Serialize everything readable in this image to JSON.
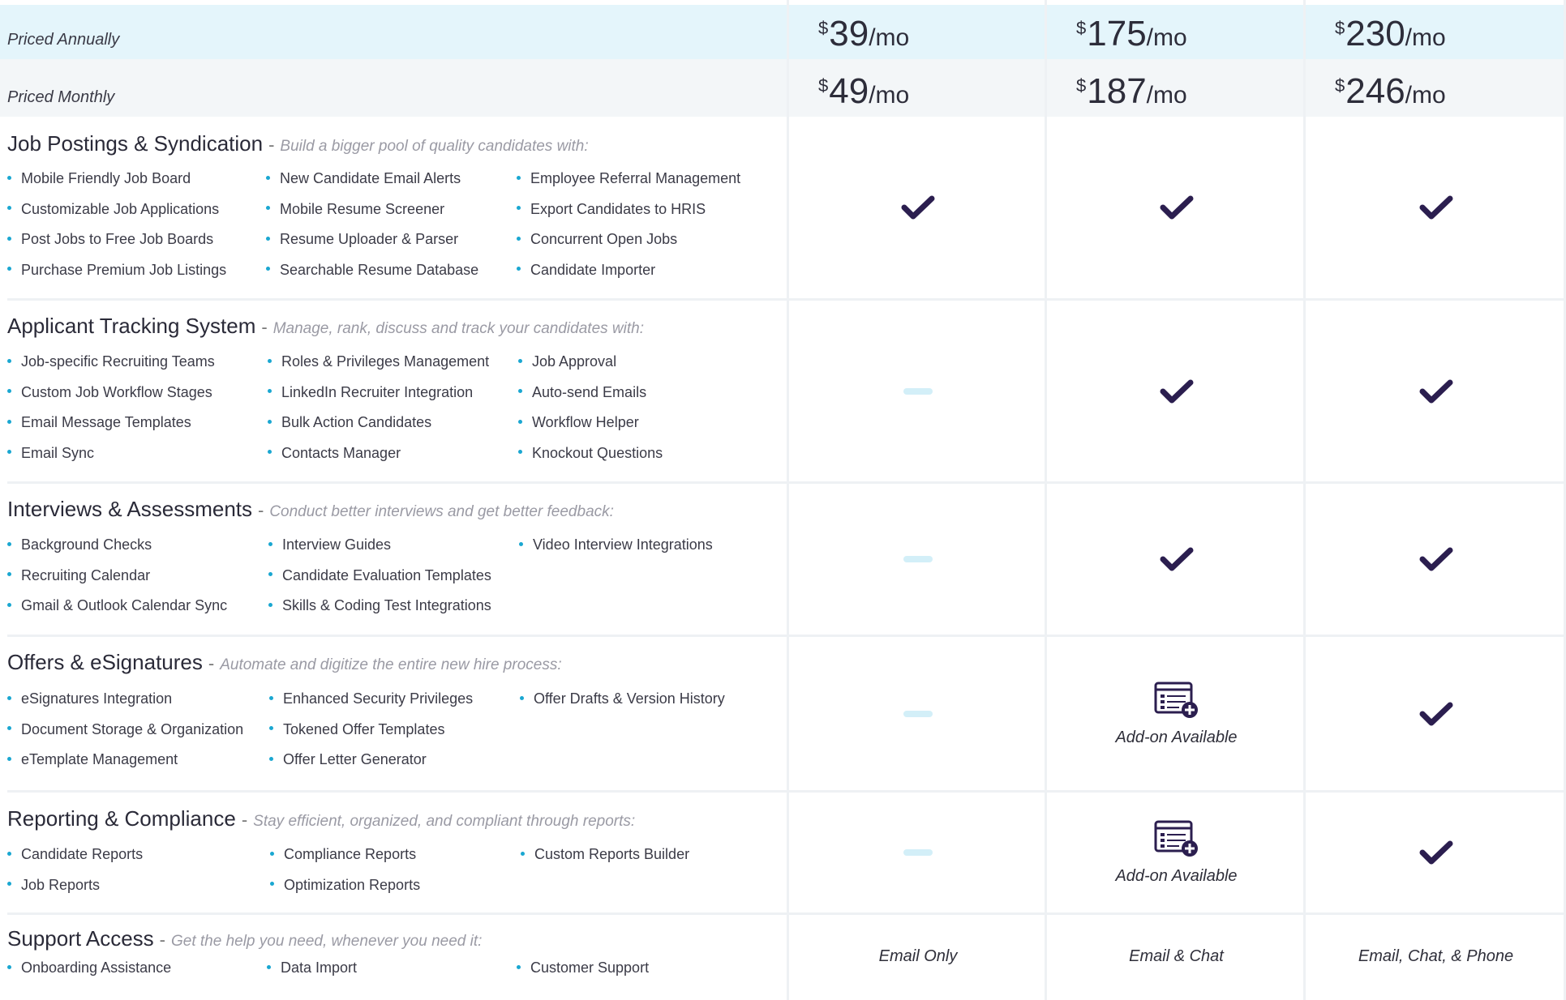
{
  "pricing": {
    "annual_label": "Priced Annually",
    "monthly_label": "Priced Monthly",
    "currency": "$",
    "per": "/mo",
    "annual": [
      "39",
      "175",
      "230"
    ],
    "monthly": [
      "49",
      "187",
      "246"
    ]
  },
  "sections": [
    {
      "title": "Job Postings & Syndication",
      "dash": "-",
      "subtitle": "Build a bigger pool of quality candidates with:",
      "features": [
        [
          "Mobile Friendly Job Board",
          "Customizable Job Applications",
          "Post Jobs to Free Job Boards",
          "Purchase Premium Job Listings"
        ],
        [
          "New Candidate Email Alerts",
          "Mobile Resume Screener",
          "Resume Uploader & Parser",
          "Searchable Resume Database"
        ],
        [
          "Employee Referral Management",
          "Export Candidates to HRIS",
          "Concurrent Open Jobs",
          "Candidate Importer"
        ]
      ],
      "tiers": [
        "check",
        "check",
        "check"
      ]
    },
    {
      "title": "Applicant Tracking System",
      "dash": "-",
      "subtitle": "Manage, rank, discuss and track your candidates with:",
      "features": [
        [
          "Job-specific Recruiting Teams",
          "Custom Job Workflow Stages",
          "Email Message Templates",
          "Email Sync"
        ],
        [
          "Roles & Privileges Management",
          "LinkedIn Recruiter Integration",
          "Bulk Action Candidates",
          "Contacts Manager"
        ],
        [
          "Job Approval",
          "Auto-send Emails",
          "Workflow Helper",
          "Knockout Questions"
        ]
      ],
      "tiers": [
        "none",
        "check",
        "check"
      ]
    },
    {
      "title": "Interviews & Assessments",
      "dash": "-",
      "subtitle": "Conduct better interviews and get better feedback:",
      "features": [
        [
          "Background Checks",
          "Recruiting Calendar",
          "Gmail & Outlook Calendar Sync"
        ],
        [
          "Interview Guides",
          "Candidate Evaluation Templates",
          "Skills & Coding Test Integrations"
        ],
        [
          "Video Interview Integrations"
        ]
      ],
      "tiers": [
        "none",
        "check",
        "check"
      ]
    },
    {
      "title": "Offers & eSignatures",
      "dash": "-",
      "subtitle": "Automate and digitize the entire new hire process:",
      "features": [
        [
          "eSignatures Integration",
          "Document Storage & Organization",
          "eTemplate Management"
        ],
        [
          "Enhanced Security Privileges",
          "Tokened Offer Templates",
          "Offer Letter Generator"
        ],
        [
          "Offer Drafts & Version History"
        ]
      ],
      "tiers": [
        "none",
        "addon",
        "check"
      ]
    },
    {
      "title": "Reporting & Compliance",
      "dash": "-",
      "subtitle": "Stay efficient, organized, and compliant through reports:",
      "features": [
        [
          "Candidate Reports",
          "Job Reports"
        ],
        [
          "Compliance Reports",
          "Optimization Reports"
        ],
        [
          "Custom Reports Builder"
        ]
      ],
      "tiers": [
        "none",
        "addon",
        "check"
      ]
    },
    {
      "title": "Support Access",
      "dash": "-",
      "subtitle": "Get the help you need, whenever you need it:",
      "features": [
        [
          "Onboarding Assistance"
        ],
        [
          "Data Import"
        ],
        [
          "Customer Support"
        ]
      ],
      "tiers": [
        "Email Only",
        "Email & Chat",
        "Email, Chat, & Phone"
      ]
    }
  ],
  "addon_label": "Add-on Available",
  "colors": {
    "check": "#2b1e4f",
    "bullet": "#1aa7d1",
    "annual_bg": "#e4f5fb",
    "monthly_bg": "#f3f6f8",
    "none_dash": "#d3eff8"
  },
  "icons": {
    "check": "checkmark-icon",
    "none": "dash-icon",
    "addon": "addon-browser-icon"
  }
}
